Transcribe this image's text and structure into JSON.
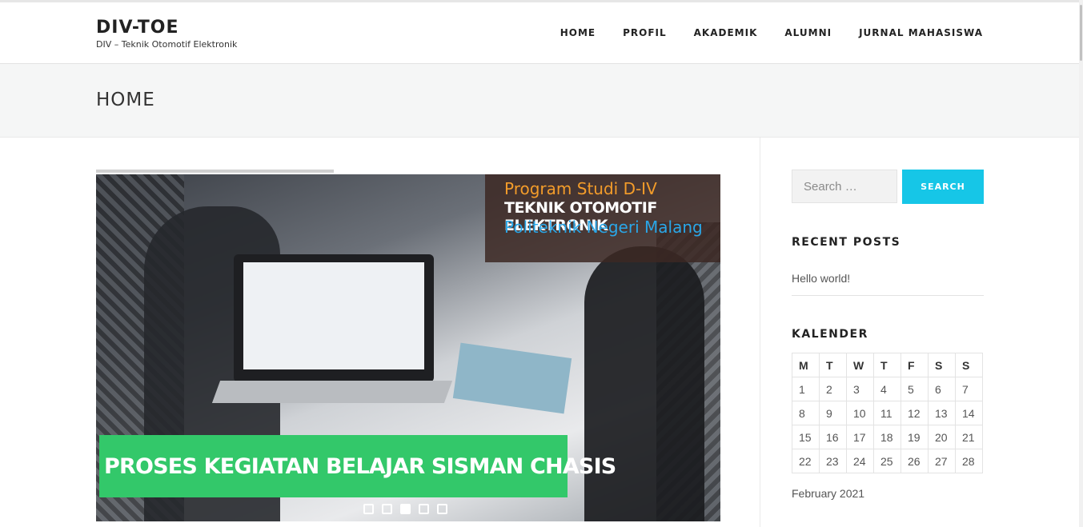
{
  "site": {
    "title": "DIV-TOE",
    "tagline": "DIV – Teknik Otomotif Elektronik"
  },
  "nav": [
    {
      "label": "HOME"
    },
    {
      "label": "PROFIL"
    },
    {
      "label": "AKADEMIK"
    },
    {
      "label": "ALUMNI"
    },
    {
      "label": "JURNAL MAHASISWA"
    }
  ],
  "page": {
    "title": "HOME"
  },
  "slider": {
    "tag_line1": "Program Studi D-IV",
    "tag_line2": "TEKNIK OTOMOTIF ELEKTRONIK",
    "tag_line3": "Politeknik Negeri Malang",
    "caption": "PROSES KEGIATAN BELAJAR  SISMAN CHASIS",
    "slide_count": 5,
    "active_slide": 3
  },
  "sidebar": {
    "search": {
      "placeholder": "Search …",
      "button_label": "SEARCH"
    },
    "recent_posts": {
      "title": "RECENT POSTS",
      "items": [
        "Hello world!"
      ]
    },
    "calendar": {
      "title": "KALENDER",
      "days": [
        "M",
        "T",
        "W",
        "T",
        "F",
        "S",
        "S"
      ],
      "weeks": [
        [
          "1",
          "2",
          "3",
          "4",
          "5",
          "6",
          "7"
        ],
        [
          "8",
          "9",
          "10",
          "11",
          "12",
          "13",
          "14"
        ],
        [
          "15",
          "16",
          "17",
          "18",
          "19",
          "20",
          "21"
        ],
        [
          "22",
          "23",
          "24",
          "25",
          "26",
          "27",
          "28"
        ]
      ],
      "month_label": "February 2021"
    }
  },
  "colors": {
    "accent": "#16c6e7",
    "caption_green": "#33c86a",
    "tag_orange": "#f39c2a",
    "tag_blue": "#2aa7e8"
  }
}
